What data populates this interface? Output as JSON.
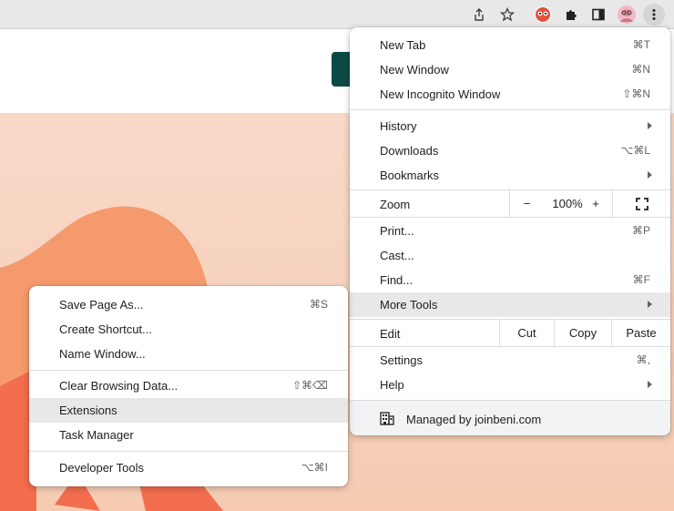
{
  "colors": {
    "toolbar_bg": "#e8e8e8",
    "menu_highlight": "#e8e8e8",
    "page_hero": "#f8d9c9",
    "hero_shape": "#f59a6c",
    "cta_button": "#0e4a45"
  },
  "toolbar": {
    "icons": [
      "share-icon",
      "bookmark-star-icon",
      "extension-avatar-icon",
      "puzzle-extensions-icon",
      "side-panel-icon",
      "profile-avatar-icon",
      "kebab-menu-icon"
    ]
  },
  "menu": {
    "items": [
      {
        "label": "New Tab",
        "shortcut": "⌘T"
      },
      {
        "label": "New Window",
        "shortcut": "⌘N"
      },
      {
        "label": "New Incognito Window",
        "shortcut": "⇧⌘N"
      },
      {
        "label": "History",
        "shortcut": ""
      },
      {
        "label": "Downloads",
        "shortcut": "⌥⌘L"
      },
      {
        "label": "Bookmarks",
        "shortcut": ""
      },
      {
        "label": "Print...",
        "shortcut": "⌘P"
      },
      {
        "label": "Cast...",
        "shortcut": ""
      },
      {
        "label": "Find...",
        "shortcut": "⌘F"
      },
      {
        "label": "More Tools",
        "shortcut": ""
      },
      {
        "label": "Settings",
        "shortcut": "⌘,"
      },
      {
        "label": "Help",
        "shortcut": ""
      }
    ],
    "zoom": {
      "label": "Zoom",
      "minus": "−",
      "value": "100%",
      "plus": "+"
    },
    "edit": {
      "label": "Edit",
      "cut": "Cut",
      "copy": "Copy",
      "paste": "Paste"
    },
    "managed": "Managed by joinbeni.com"
  },
  "submenu": {
    "items": [
      {
        "label": "Save Page As...",
        "shortcut": "⌘S"
      },
      {
        "label": "Create Shortcut...",
        "shortcut": ""
      },
      {
        "label": "Name Window...",
        "shortcut": ""
      },
      {
        "label": "Clear Browsing Data...",
        "shortcut": "⇧⌘⌫"
      },
      {
        "label": "Extensions",
        "shortcut": ""
      },
      {
        "label": "Task Manager",
        "shortcut": ""
      },
      {
        "label": "Developer Tools",
        "shortcut": "⌥⌘I"
      }
    ]
  }
}
